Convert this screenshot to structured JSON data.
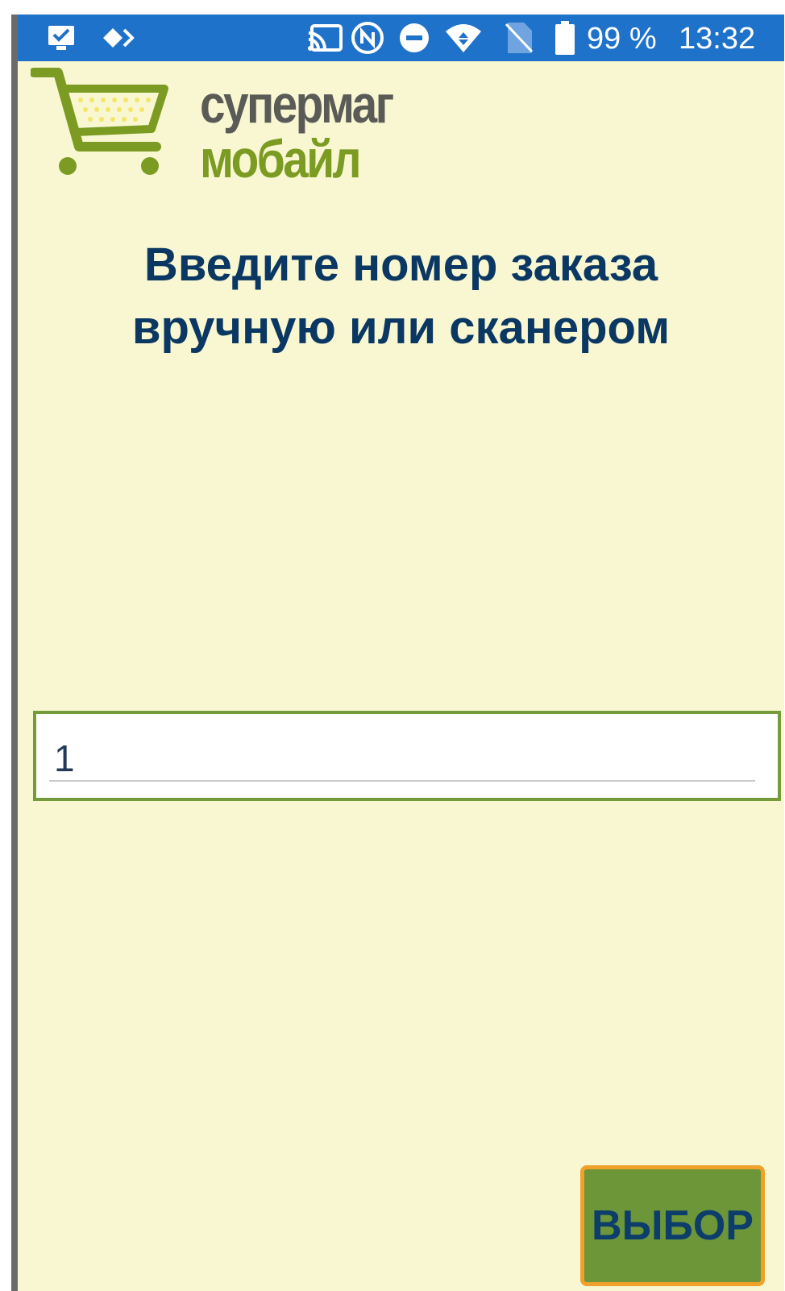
{
  "status_bar": {
    "icons": [
      "screenshot-notification-icon",
      "code-diamond-icon",
      "cast-icon",
      "nfc-icon",
      "do-not-disturb-icon",
      "wifi-icon",
      "no-sim-icon",
      "battery-icon"
    ],
    "battery": "99 %",
    "time": "13:32",
    "color": "#1f72c9"
  },
  "logo": {
    "line1": "супермаг",
    "line2": "мобайл",
    "icon": "shopping-cart-icon",
    "cart_color": "#7b9b22"
  },
  "heading": {
    "line1": "Введите номер заказа",
    "line2": "вручную или сканером"
  },
  "order_input": {
    "value": "1"
  },
  "choose_button": {
    "label": "ВЫБОР"
  },
  "colors": {
    "background": "#f8f7d2",
    "heading": "#0b3763",
    "input_border": "#759b3a",
    "button_fill": "#6c9638",
    "button_border": "#f0a129"
  }
}
